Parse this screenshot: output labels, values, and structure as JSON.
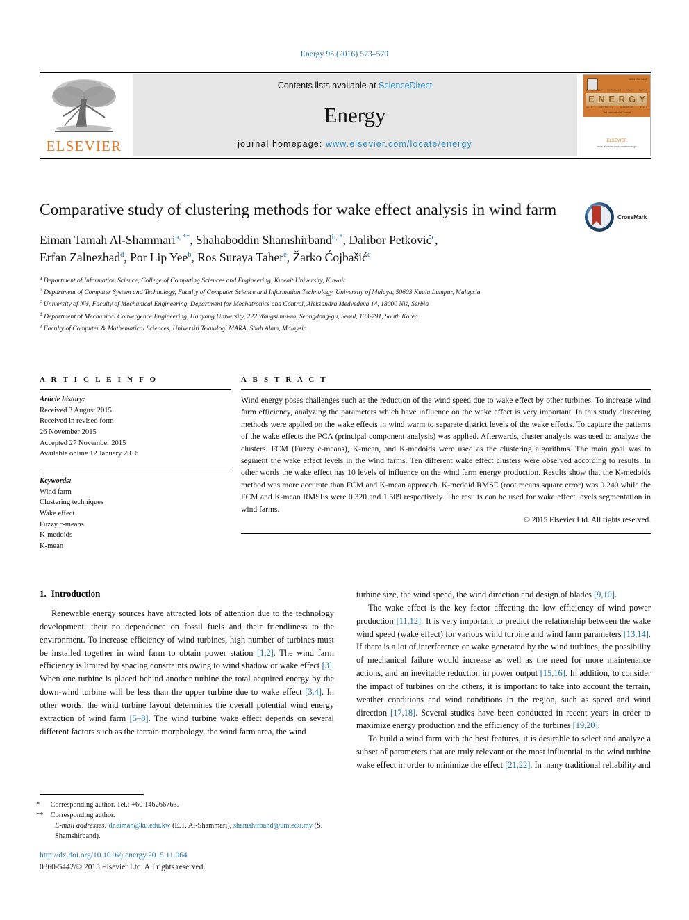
{
  "running_head": "Energy 95 (2016) 573–579",
  "masthead": {
    "publisher_name": "ELSEVIER",
    "contents_prefix": "Contents lists available at ",
    "contents_link": "ScienceDirect",
    "journal_name": "Energy",
    "homepage_prefix": "journal homepage: ",
    "homepage_url": "www.elsevier.com/locate/energy",
    "cover": {
      "title_letters": [
        "E",
        "N",
        "E",
        "R",
        "G",
        "Y"
      ],
      "top_right_code": "ISSN 0360-5442",
      "head_labels": [
        "ENVIRONMENT",
        "ECONOMICS",
        "POLICY",
        "SUPPLY"
      ],
      "sub_labels": [
        "HEAT",
        "ELECTRICITY",
        "TRANSPORT",
        "FUELS"
      ],
      "tagline": "The International Journal",
      "publisher": "ELSEVIER",
      "publisher_sub": "www.elsevier.com/locate/energy"
    }
  },
  "article": {
    "title": "Comparative study of clustering methods for wake effect analysis in wind farm",
    "crossmark_label": "CrossMark",
    "authors_line1": "Eiman Tamah Al-Shammari",
    "authors": [
      {
        "name": "Eiman Tamah Al-Shammari",
        "marks": "a, **",
        "sep": ", "
      },
      {
        "name": "Shahaboddin Shamshirband",
        "marks": "b, *",
        "sep": ", "
      },
      {
        "name": "Dalibor Petković",
        "marks": "c",
        "sep": ", "
      },
      {
        "name": "Erfan Zalnezhad",
        "marks": "d",
        "sep": ", "
      },
      {
        "name": "Por Lip Yee",
        "marks": "b",
        "sep": ", "
      },
      {
        "name": "Ros Suraya Taher",
        "marks": "e",
        "sep": ", "
      },
      {
        "name": "Žarko Ćojbašić",
        "marks": "c",
        "sep": ""
      }
    ],
    "affiliations": [
      {
        "mark": "a",
        "text": "Department of Information Science, College of Computing Sciences and Engineering, Kuwait University, Kuwait"
      },
      {
        "mark": "b",
        "text": "Department of Computer System and Technology, Faculty of Computer Science and Information Technology, University of Malaya, 50603 Kuala Lumpur, Malaysia"
      },
      {
        "mark": "c",
        "text": "University of Niš, Faculty of Mechanical Engineering, Department for Mechatronics and Control, Aleksandra Medvedeva 14, 18000 Niš, Serbia"
      },
      {
        "mark": "d",
        "text": "Department of Mechanical Convergence Engineering, Hanyang University, 222 Wangsimni-ro, Seongdong-gu, Seoul, 133-791, South Korea"
      },
      {
        "mark": "e",
        "text": "Faculty of Computer & Mathematical Sciences, Universiti Teknologi MARA, Shah Alam, Malaysia"
      }
    ]
  },
  "article_info": {
    "heading": "A R T I C L E  I N F O",
    "history_label": "Article history:",
    "history": [
      "Received 3 August 2015",
      "Received in revised form",
      "26 November 2015",
      "Accepted 27 November 2015",
      "Available online 12 January 2016"
    ],
    "keywords_label": "Keywords:",
    "keywords": [
      "Wind farm",
      "Clustering techniques",
      "Wake effect",
      "Fuzzy c-means",
      "K-medoids",
      "K-mean"
    ]
  },
  "abstract": {
    "heading": "A B S T R A C T",
    "text": "Wind energy poses challenges such as the reduction of the wind speed due to wake effect by other turbines. To increase wind farm efficiency, analyzing the parameters which have influence on the wake effect is very important. In this study clustering methods were applied on the wake effects in wind warm to separate district levels of the wake effects. To capture the patterns of the wake effects the PCA (principal component analysis) was applied. Afterwards, cluster analysis was used to analyze the clusters. FCM (Fuzzy c-means), K-mean, and K-medoids were used as the clustering algorithms. The main goal was to segment the wake effect levels in the wind farms. Ten different wake effect clusters were observed according to results. In other words the wake effect has 10 levels of influence on the wind farm energy production. Results show that the K-medoids method was more accurate than FCM and K-mean approach. K-medoid RMSE (root means square error) was 0.240 while the FCM and K-mean RMSEs were 0.320 and 1.509 respectively. The results can be used for wake effect levels segmentation in wind farms.",
    "copyright": "© 2015 Elsevier Ltd. All rights reserved."
  },
  "introduction": {
    "number": "1.",
    "heading": "Introduction",
    "left_paragraphs": [
      "Renewable energy sources have attracted lots of attention due to the technology development, their no dependence on fossil fuels and their friendliness to the environment. To increase efficiency of wind turbines, high number of turbines must be installed together in wind farm to obtain power station [1,2]. The wind farm efficiency is limited by spacing constraints owing to wind shadow or wake effect [3]. When one turbine is placed behind another turbine the total acquired energy by the down-wind turbine will be less than the upper turbine due to wake effect [3,4]. In other words, the wind turbine layout determines the overall potential wind energy extraction of wind farm [5–8]. The wind turbine wake effect depends on several different factors such as the terrain morphology, the wind farm area, the wind"
    ],
    "right_paragraphs": [
      "turbine size, the wind speed, the wind direction and design of blades [9,10].",
      "The wake effect is the key factor affecting the low efficiency of wind power production [11,12]. It is very important to predict the relationship between the wake wind speed (wake effect) for various wind turbine and wind farm parameters [13,14]. If there is a lot of interference or wake generated by the wind turbines, the possibility of mechanical failure would increase as well as the need for more maintenance actions, and an inevitable reduction in power output [15,16]. In addition, to consider the impact of turbines on the others, it is important to take into account the terrain, weather conditions and wind conditions in the region, such as speed and wind direction [17,18]. Several studies have been conducted in recent years in order to maximize energy production and the efficiency of the turbines [19,20].",
      "To build a wind farm with the best features, it is desirable to select and analyze a subset of parameters that are truly relevant or the most influential to the wind turbine wake effect in order to minimize the effect [21,22]. In many traditional reliability and"
    ]
  },
  "footnotes": {
    "corresponding_1_mark": "*",
    "corresponding_1": "Corresponding author. Tel.: +60 146266763.",
    "corresponding_2_mark": "**",
    "corresponding_2": "Corresponding author.",
    "email_label": "E-mail addresses:",
    "email_1": "dr.eiman@ku.edu.kw",
    "email_1_owner": "(E.T. Al-Shammari),",
    "email_2": "shamshirband@um.edu.my",
    "email_2_owner": "(S. Shamshirband)."
  },
  "footer": {
    "doi": "http://dx.doi.org/10.1016/j.energy.2015.11.064",
    "issn": "0360-5442/© 2015 Elsevier Ltd. All rights reserved."
  },
  "colors": {
    "link_blue": "#1a6ba0",
    "sciencedirect_blue": "#2a93c9",
    "elsevier_orange": "#E87722",
    "cover_orange": "#cf7a30",
    "band_grey": "#e6e6e6"
  }
}
